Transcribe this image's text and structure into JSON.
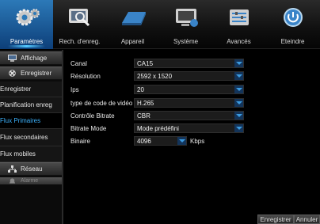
{
  "tabs": [
    {
      "label": "Paramètres",
      "icon": "gear-icon",
      "active": true
    },
    {
      "label": "Rech. d'enreg.",
      "icon": "search-icon"
    },
    {
      "label": "Appareil",
      "icon": "hard-drive-icon"
    },
    {
      "label": "Système",
      "icon": "monitor-icon"
    },
    {
      "label": "Avancés",
      "icon": "tools-icon"
    },
    {
      "label": "Eteindre",
      "icon": "power-icon"
    }
  ],
  "sidebar": {
    "items": [
      {
        "label": "Affichage",
        "icon": "display-icon"
      },
      {
        "label": "Enregistrer",
        "icon": "film-reel-icon"
      },
      {
        "label": "Enregistrer"
      },
      {
        "label": "Planification enreg"
      },
      {
        "label": "Flux Primaires",
        "active": true
      },
      {
        "label": "Flux secondaires"
      },
      {
        "label": "Flux mobiles"
      },
      {
        "label": "Réseau",
        "icon": "network-icon"
      },
      {
        "label": "Alarme",
        "icon": "alarm-icon"
      }
    ]
  },
  "form": {
    "canal": {
      "label": "Canal",
      "value": "CA15"
    },
    "resolution": {
      "label": "Résolution",
      "value": "2592 x 1520"
    },
    "ips": {
      "label": "Ips",
      "value": "20"
    },
    "codec": {
      "label": "type de code de vidéo",
      "value": "H.265"
    },
    "bitrate_control": {
      "label": "Contrôle Bitrate",
      "value": "CBR"
    },
    "bitrate_mode": {
      "label": "Bitrate Mode",
      "value": "Mode prédéfini"
    },
    "binaire": {
      "label": "Binaire",
      "value": "4096",
      "unit": "Kbps"
    }
  },
  "buttons": {
    "save": "Enregistrer",
    "cancel": "Annuler"
  },
  "colors": {
    "accent": "#2c79b8",
    "active_text": "#3db4ff",
    "dropdown": "#13345a"
  }
}
